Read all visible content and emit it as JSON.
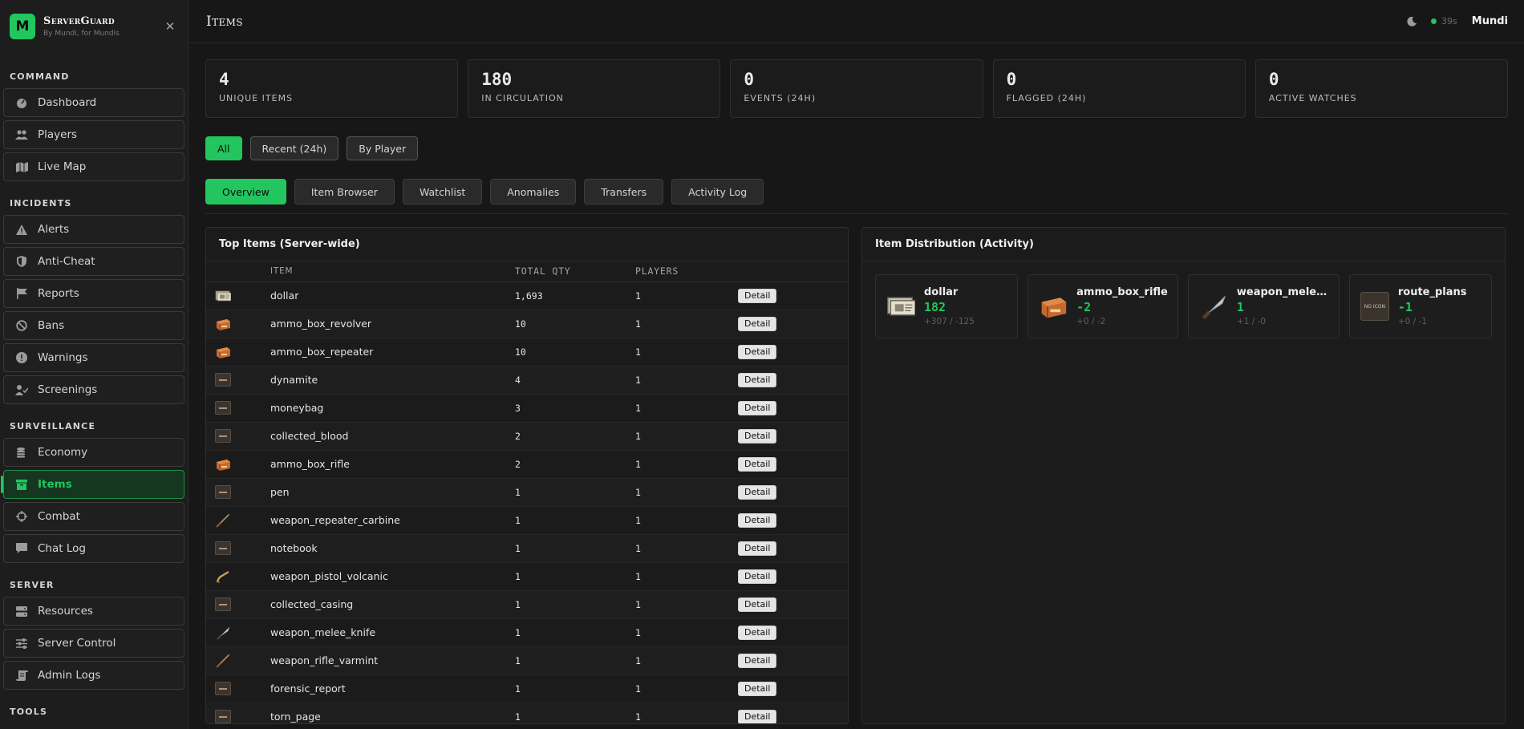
{
  "brand": {
    "logo_letter": "M",
    "title": "ServerGuard",
    "subtitle": "By Mundi, for Mundis"
  },
  "sidebar": {
    "sections": [
      {
        "label": "COMMAND",
        "items": [
          {
            "label": "Dashboard",
            "icon": "dashboard-icon"
          },
          {
            "label": "Players",
            "icon": "users-icon"
          },
          {
            "label": "Live Map",
            "icon": "map-icon"
          }
        ]
      },
      {
        "label": "INCIDENTS",
        "items": [
          {
            "label": "Alerts",
            "icon": "warning-icon"
          },
          {
            "label": "Anti-Cheat",
            "icon": "shield-icon"
          },
          {
            "label": "Reports",
            "icon": "flag-icon"
          },
          {
            "label": "Bans",
            "icon": "ban-icon"
          },
          {
            "label": "Warnings",
            "icon": "exclamation-icon"
          },
          {
            "label": "Screenings",
            "icon": "user-check-icon"
          }
        ]
      },
      {
        "label": "SURVEILLANCE",
        "items": [
          {
            "label": "Economy",
            "icon": "coins-icon"
          },
          {
            "label": "Items",
            "icon": "box-icon",
            "active": true
          },
          {
            "label": "Combat",
            "icon": "crosshair-icon"
          },
          {
            "label": "Chat Log",
            "icon": "chat-icon"
          }
        ]
      },
      {
        "label": "SERVER",
        "items": [
          {
            "label": "Resources",
            "icon": "server-icon"
          },
          {
            "label": "Server Control",
            "icon": "sliders-icon"
          },
          {
            "label": "Admin Logs",
            "icon": "scroll-icon"
          }
        ]
      },
      {
        "label": "TOOLS",
        "items": []
      }
    ]
  },
  "header": {
    "title": "Items",
    "timer": "39s",
    "user": "Mundi"
  },
  "stats": [
    {
      "value": "4",
      "label": "Unique Items"
    },
    {
      "value": "180",
      "label": "In Circulation"
    },
    {
      "value": "0",
      "label": "Events (24h)"
    },
    {
      "value": "0",
      "label": "Flagged (24h)"
    },
    {
      "value": "0",
      "label": "Active Watches"
    }
  ],
  "filters": {
    "all": "All",
    "recent": "Recent (24h)",
    "by_player": "By Player"
  },
  "tabs": {
    "overview": "Overview",
    "item_browser": "Item Browser",
    "watchlist": "Watchlist",
    "anomalies": "Anomalies",
    "transfers": "Transfers",
    "activity_log": "Activity Log"
  },
  "top_items": {
    "title": "Top Items (Server-wide)",
    "headers": {
      "item": "ITEM",
      "total_qty": "TOTAL QTY",
      "players": "PLAYERS"
    },
    "detail_label": "Detail",
    "rows": [
      {
        "item": "dollar",
        "qty": "1,693",
        "players": "1",
        "icon": "cash-icon"
      },
      {
        "item": "ammo_box_revolver",
        "qty": "10",
        "players": "1",
        "icon": "ammo-box-icon"
      },
      {
        "item": "ammo_box_repeater",
        "qty": "10",
        "players": "1",
        "icon": "ammo-box-icon"
      },
      {
        "item": "dynamite",
        "qty": "4",
        "players": "1",
        "icon": "no-icon"
      },
      {
        "item": "moneybag",
        "qty": "3",
        "players": "1",
        "icon": "no-icon"
      },
      {
        "item": "collected_blood",
        "qty": "2",
        "players": "1",
        "icon": "no-icon"
      },
      {
        "item": "ammo_box_rifle",
        "qty": "2",
        "players": "1",
        "icon": "ammo-box-icon"
      },
      {
        "item": "pen",
        "qty": "1",
        "players": "1",
        "icon": "no-icon"
      },
      {
        "item": "weapon_repeater_carbine",
        "qty": "1",
        "players": "1",
        "icon": "rifle-icon"
      },
      {
        "item": "notebook",
        "qty": "1",
        "players": "1",
        "icon": "no-icon"
      },
      {
        "item": "weapon_pistol_volcanic",
        "qty": "1",
        "players": "1",
        "icon": "pistol-icon"
      },
      {
        "item": "collected_casing",
        "qty": "1",
        "players": "1",
        "icon": "no-icon"
      },
      {
        "item": "weapon_melee_knife",
        "qty": "1",
        "players": "1",
        "icon": "knife-icon"
      },
      {
        "item": "weapon_rifle_varmint",
        "qty": "1",
        "players": "1",
        "icon": "rifle-icon"
      },
      {
        "item": "forensic_report",
        "qty": "1",
        "players": "1",
        "icon": "no-icon"
      },
      {
        "item": "torn_page",
        "qty": "1",
        "players": "1",
        "icon": "no-icon"
      }
    ]
  },
  "distribution": {
    "title": "Item Distribution (Activity)",
    "no_icon_text": "NO ICON",
    "cards": [
      {
        "name": "dollar",
        "net": "182",
        "detail": "+307 / -125",
        "icon": "cash-icon"
      },
      {
        "name": "ammo_box_rifle",
        "net": "-2",
        "detail": "+0 / -2",
        "icon": "ammo-box-icon"
      },
      {
        "name": "weapon_melee_...",
        "net": "1",
        "detail": "+1 / -0",
        "icon": "knife-icon"
      },
      {
        "name": "route_plans",
        "net": "-1",
        "detail": "+0 / -1",
        "icon": "no-icon"
      }
    ]
  },
  "colors": {
    "accent": "#22c55e",
    "background": "#171717",
    "panel": "#1b1b1b"
  }
}
